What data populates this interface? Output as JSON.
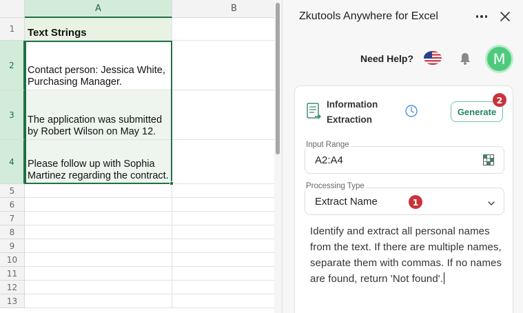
{
  "sheet": {
    "columns": [
      "A",
      "B"
    ],
    "rows": [
      "1",
      "2",
      "3",
      "4",
      "5",
      "6",
      "7",
      "8",
      "9",
      "10",
      "11",
      "12",
      "13"
    ],
    "header_cell": "Text Strings",
    "cells": [
      "Contact person: Jessica White, Purchasing Manager.",
      "The application was submitted by Robert Wilson on May 12.",
      "Please follow up with Sophia Martinez regarding the contract."
    ]
  },
  "pane": {
    "title": "Zkutools Anywhere for Excel",
    "help_text": "Need Help?",
    "avatar_letter": "M",
    "tool": {
      "name": "Information Extraction",
      "generate_label": "Generate",
      "generate_badge": "2",
      "input_range_label": "Input Range",
      "input_range_value": "A2:A4",
      "processing_type_label": "Processing Type",
      "processing_type_value": "Extract Name",
      "processing_badge": "1",
      "prompt": "Identify and extract all personal names from the text. If there are multiple names, separate them with commas. If no names are found, return 'Not found'."
    },
    "icons": {
      "more": "more-horizontal-icon",
      "close": "close-icon",
      "flag": "us-flag-icon",
      "bell": "bell-icon",
      "tool": "document-extract-icon",
      "history": "clock-icon",
      "range_picker": "grid-select-icon",
      "dropdown": "chevron-down-icon"
    },
    "colors": {
      "accent_green": "#1e7145",
      "generate_text": "#238760",
      "badge_red": "#c9343c",
      "avatar_green": "#4ccb7c"
    }
  }
}
